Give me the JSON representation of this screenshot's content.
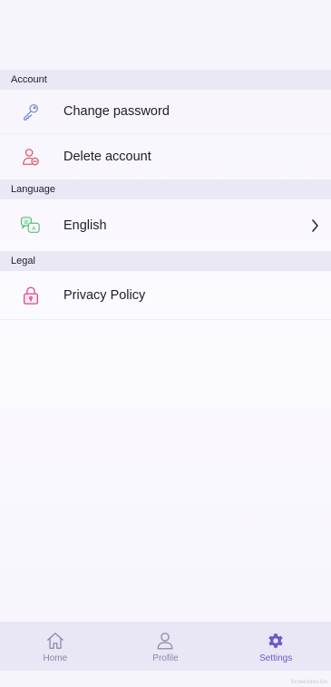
{
  "sections": {
    "account": {
      "title": "Account",
      "items": [
        {
          "label": "Change password",
          "icon": "key-icon"
        },
        {
          "label": "Delete account",
          "icon": "user-remove-icon"
        }
      ]
    },
    "language": {
      "title": "Language",
      "items": [
        {
          "label": "English",
          "icon": "translate-icon",
          "has_chevron": true
        }
      ]
    },
    "legal": {
      "title": "Legal",
      "items": [
        {
          "label": "Privacy Policy",
          "icon": "lock-icon"
        }
      ]
    }
  },
  "bottom_nav": {
    "items": [
      {
        "label": "Home",
        "icon": "home-icon",
        "active": false
      },
      {
        "label": "Profile",
        "icon": "profile-icon",
        "active": false
      },
      {
        "label": "Settings",
        "icon": "gear-icon",
        "active": true
      }
    ]
  },
  "watermark": "Screenshot.fun",
  "colors": {
    "accent": "#6a5ac9",
    "section_bg": "#ebe8f6",
    "nav_bg": "#e9e6f5",
    "icon_key": "#7b8bd8",
    "icon_delete": "#e05a6a",
    "icon_language": "#5bbf7a",
    "icon_lock": "#d94a8a"
  }
}
